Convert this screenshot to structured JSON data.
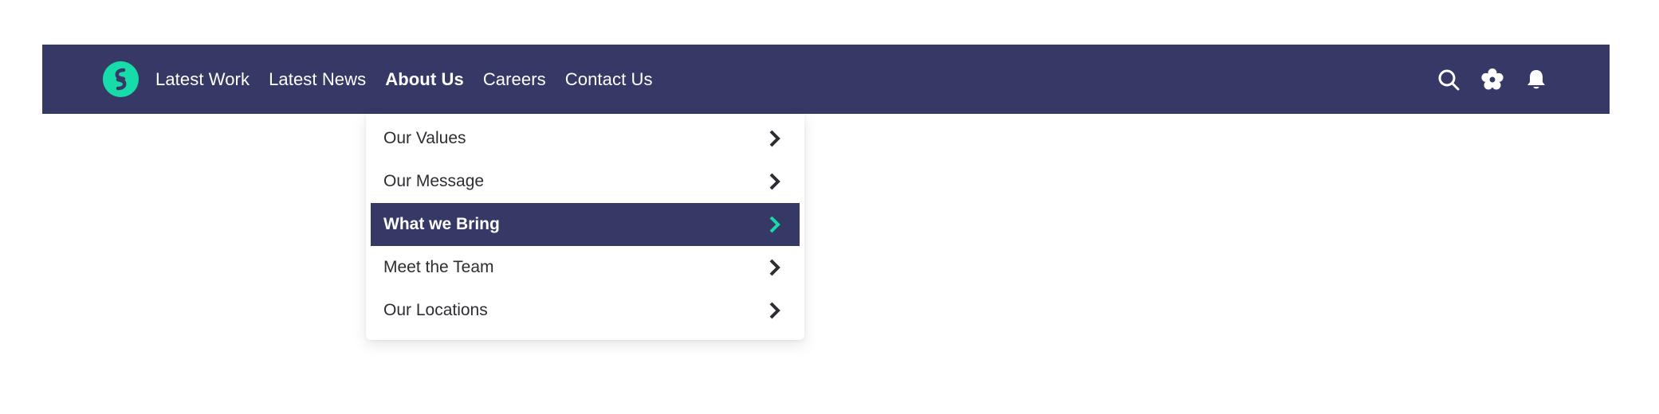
{
  "nav": {
    "links": [
      {
        "label": "Latest Work",
        "active": false
      },
      {
        "label": "Latest News",
        "active": false
      },
      {
        "label": "About Us",
        "active": true
      },
      {
        "label": "Careers",
        "active": false
      },
      {
        "label": "Contact Us",
        "active": false
      }
    ],
    "icons": [
      "search-icon",
      "settings-icon",
      "bell-icon"
    ]
  },
  "dropdown": {
    "items": [
      {
        "label": "Our Values",
        "active": false
      },
      {
        "label": "Our Message",
        "active": false
      },
      {
        "label": "What we Bring",
        "active": true
      },
      {
        "label": "Meet the Team",
        "active": false
      },
      {
        "label": "Our Locations",
        "active": false
      }
    ]
  },
  "colors": {
    "nav_bg": "#363966",
    "accent": "#17dba8",
    "text_dark": "#2d2d33",
    "white": "#ffffff"
  }
}
